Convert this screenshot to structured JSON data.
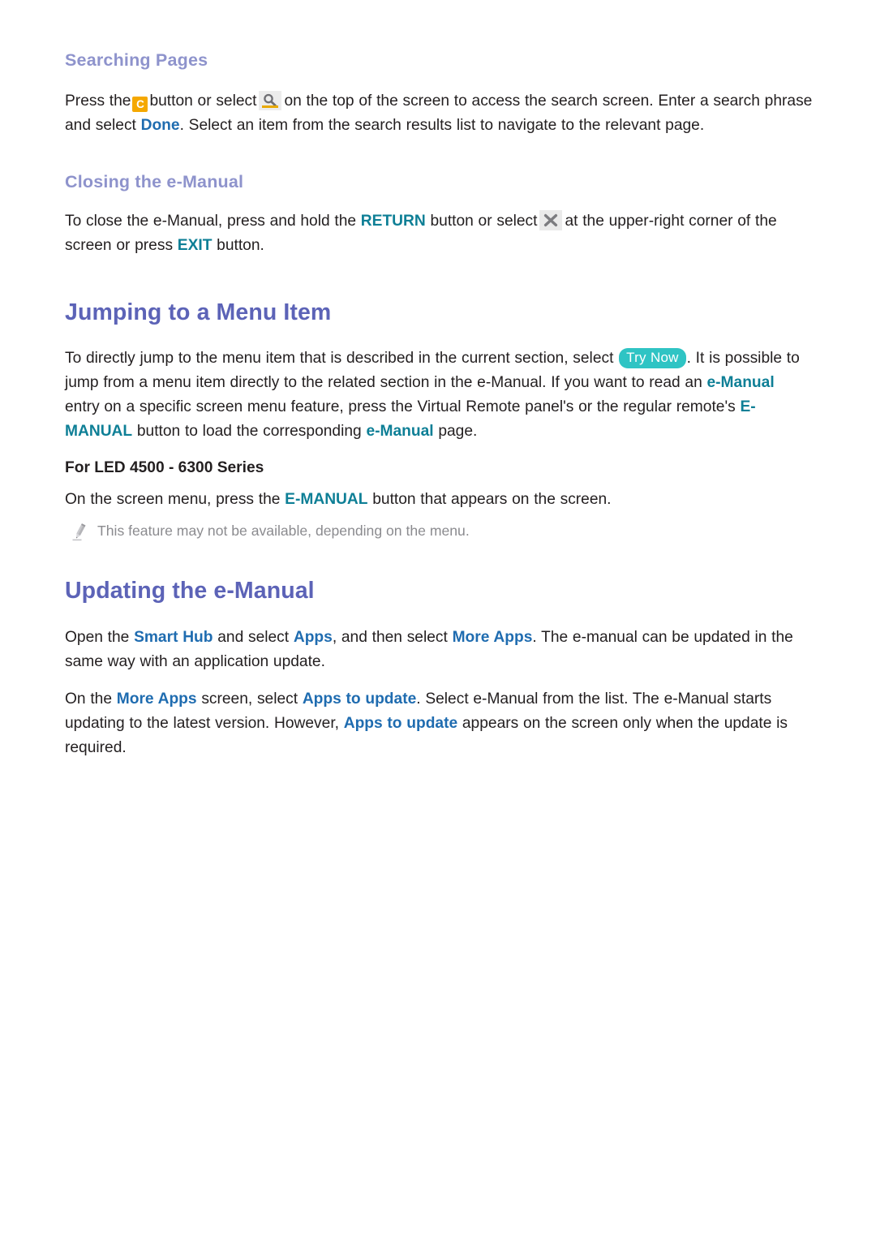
{
  "page": {
    "background": "#ffffff",
    "heading_h1_color": "#5c63b7",
    "heading_h2_color": "#8e93cc",
    "body_color": "#231f20",
    "link_teal_color": "#0e7f96",
    "link_blue_color": "#1f6cb0",
    "note_color": "#8b8b8f"
  },
  "sections": {
    "searching_pages": {
      "heading": "Searching Pages",
      "paragraph": {
        "t1": "Press the",
        "icon_c_label": "C",
        "t2": "button or select",
        "icon_search_name": "search-icon",
        "t3": "on the top of the screen to access the search screen. Enter a search phrase and select",
        "link_done": "Done",
        "t4": ". Select an item from the search results list to navigate to the relevant page."
      }
    },
    "closing_emanual": {
      "heading": "Closing the e-Manual",
      "paragraph": {
        "t1": "To close the e-Manual, press and hold the",
        "link_return": "RETURN",
        "t2": "button or select",
        "icon_close_name": "close-icon",
        "t3": "at the upper-right corner of the screen or press",
        "link_exit": "EXIT",
        "t4": "button."
      }
    },
    "jumping_to_menu_item": {
      "heading": "Jumping to a Menu Item",
      "paragraph": {
        "t1": "To directly jump to the menu item that is described in the current section, select",
        "badge_try_now": "Try Now",
        "badge_color": "#2fc4c4",
        "t2": ". It is possible to jump from a menu item directly to the related section in the e-Manual. If you want to read an",
        "link_emanual_1": "e-Manual",
        "t3": "entry on a specific screen menu feature, press the Virtual Remote panel's or the regular remote's",
        "link_emanual_btn": "E-MANUAL",
        "t4": "button to load the corresponding",
        "link_emanual_2": "e-Manual",
        "t5": "page."
      },
      "subhead": "For LED 4500 - 6300 Series",
      "sub_paragraph": {
        "t1": "On the screen menu, press the",
        "link_emanual_btn": "E-MANUAL",
        "t2": "button that appears on the screen."
      },
      "note": {
        "icon": "pencil-icon",
        "text": "This feature may not be available, depending on the menu."
      }
    },
    "updating_emanual": {
      "heading": "Updating the e-Manual",
      "paragraph_1": {
        "t1": "Open the",
        "link_smart_hub": "Smart Hub",
        "t2": "and select",
        "link_apps": "Apps",
        "t3": ", and then select",
        "link_more_apps": "More Apps",
        "t4": ". The e-manual can be updated in the same way with an application update."
      },
      "paragraph_2": {
        "t1": "On the",
        "link_more_apps": "More Apps",
        "t2": "screen, select",
        "link_apps_to_update_1": "Apps to update",
        "t3": ". Select e-Manual from the list. The e-Manual starts updating to the latest version. However,",
        "link_apps_to_update_2": "Apps to update",
        "t4": "appears on the screen only when the update is required."
      }
    }
  }
}
